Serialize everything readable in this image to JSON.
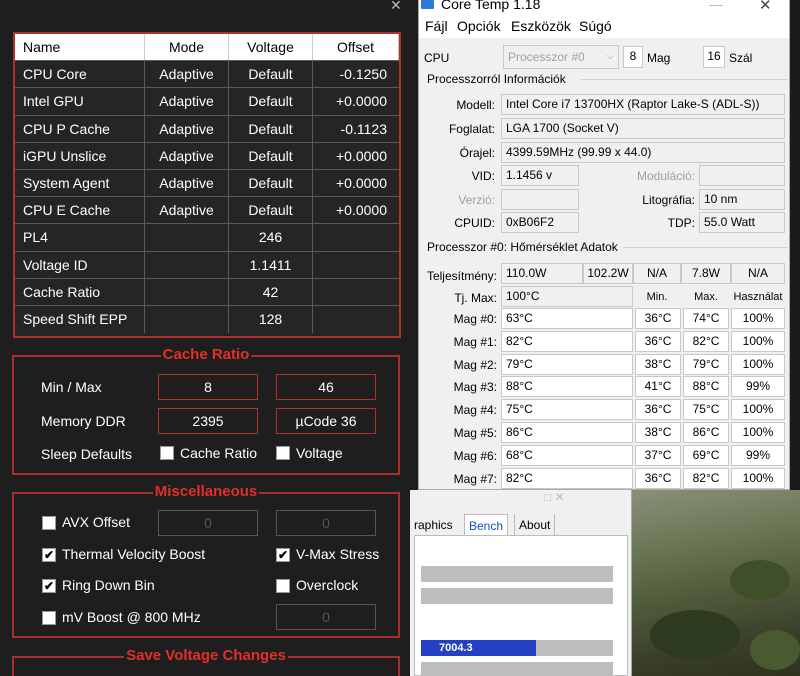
{
  "throttlestop": {
    "close_glyph": "✕",
    "table": {
      "headers": [
        "Name",
        "Mode",
        "Voltage",
        "Offset"
      ],
      "rows": [
        [
          "CPU Core",
          "Adaptive",
          "Default",
          "-0.1250"
        ],
        [
          "Intel GPU",
          "Adaptive",
          "Default",
          "+0.0000"
        ],
        [
          "CPU P Cache",
          "Adaptive",
          "Default",
          "-0.1123"
        ],
        [
          "iGPU Unslice",
          "Adaptive",
          "Default",
          "+0.0000"
        ],
        [
          "System Agent",
          "Adaptive",
          "Default",
          "+0.0000"
        ],
        [
          "CPU E Cache",
          "Adaptive",
          "Default",
          "+0.0000"
        ],
        [
          "PL4",
          "",
          "246",
          ""
        ],
        [
          "Voltage ID",
          "",
          "1.1411",
          ""
        ],
        [
          "Cache Ratio",
          "",
          "42",
          ""
        ],
        [
          "Speed Shift EPP",
          "",
          "128",
          ""
        ]
      ]
    },
    "cache_ratio": {
      "title": "Cache Ratio",
      "min_max_label": "Min / Max",
      "min_value": "8",
      "max_value": "46",
      "memory_label": "Memory DDR",
      "memory_value": "2395",
      "ucode_value": "µCode 36",
      "sleep_label": "Sleep Defaults",
      "chk_cache_ratio": "Cache Ratio",
      "chk_voltage": "Voltage"
    },
    "misc": {
      "title": "Miscellaneous",
      "avx_offset": "AVX Offset",
      "avx_value1": "0",
      "avx_value2": "0",
      "thermal_velocity": "Thermal Velocity Boost",
      "vmax_stress": "V-Max Stress",
      "ring_down_bin": "Ring Down Bin",
      "overclock": "Overclock",
      "mv_boost": "mV Boost @ 800 MHz",
      "mv_value": "0",
      "checked_glyph": "✔"
    },
    "save_title": "Save Voltage Changes"
  },
  "coretemp": {
    "title": "Core Temp 1.18",
    "minimize_glyph": "—",
    "close_glyph": "✕",
    "menu": [
      "Fájl",
      "Opciók",
      "Eszközök",
      "Súgó"
    ],
    "cpu_label": "CPU",
    "cpu_select": "Processzor #0",
    "cores": "8",
    "cores_label": "Mag",
    "threads": "16",
    "threads_label": "Szál",
    "info_section": "Processzorról Információk",
    "model_label": "Modell:",
    "model_value": "Intel Core i7 13700HX (Raptor Lake-S (ADL-S))",
    "socket_label": "Foglalat:",
    "socket_value": "LGA 1700 (Socket V)",
    "clock_label": "Órajel:",
    "clock_value": "4399.59MHz (99.99 x 44.0)",
    "vid_label": "VID:",
    "vid_value": "1.1456 v",
    "modulation_label": "Moduláció:",
    "version_label": "Verzió:",
    "litography_label": "Litográfia:",
    "litography_value": "10 nm",
    "cpuid_label": "CPUID:",
    "cpuid_value": "0xB06F2",
    "tdp_label": "TDP:",
    "tdp_value": "55.0 Watt",
    "temp_section": "Processzor #0: Hőmérséklet Adatok",
    "power_label": "Teljesítmény:",
    "power_values": [
      "110.0W",
      "102.2W",
      "N/A",
      "7.8W",
      "N/A"
    ],
    "tjmax_label": "Tj. Max:",
    "tjmax_value": "100°C",
    "col_min": "Min.",
    "col_max": "Max.",
    "col_usage": "Használat",
    "cores_temps": [
      {
        "label": "Mag #0:",
        "temp": "63°C",
        "min": "36°C",
        "max": "74°C",
        "load": "100%"
      },
      {
        "label": "Mag #1:",
        "temp": "82°C",
        "min": "36°C",
        "max": "82°C",
        "load": "100%"
      },
      {
        "label": "Mag #2:",
        "temp": "79°C",
        "min": "38°C",
        "max": "79°C",
        "load": "100%"
      },
      {
        "label": "Mag #3:",
        "temp": "88°C",
        "min": "41°C",
        "max": "88°C",
        "load": "99%"
      },
      {
        "label": "Mag #4:",
        "temp": "75°C",
        "min": "36°C",
        "max": "75°C",
        "load": "100%"
      },
      {
        "label": "Mag #5:",
        "temp": "86°C",
        "min": "38°C",
        "max": "86°C",
        "load": "100%"
      },
      {
        "label": "Mag #6:",
        "temp": "68°C",
        "min": "37°C",
        "max": "69°C",
        "load": "99%"
      },
      {
        "label": "Mag #7:",
        "temp": "82°C",
        "min": "36°C",
        "max": "82°C",
        "load": "100%"
      }
    ]
  },
  "bench": {
    "ghost_buttons": "□   ✕",
    "tabs": [
      "raphics",
      "Bench",
      "About"
    ],
    "score": "7004.3",
    "score_fill_fraction": 0.6
  },
  "colors": {
    "ts_accent": "#b0302c",
    "ts_title": "#e0302a",
    "bench_bar": "#2540c4"
  }
}
